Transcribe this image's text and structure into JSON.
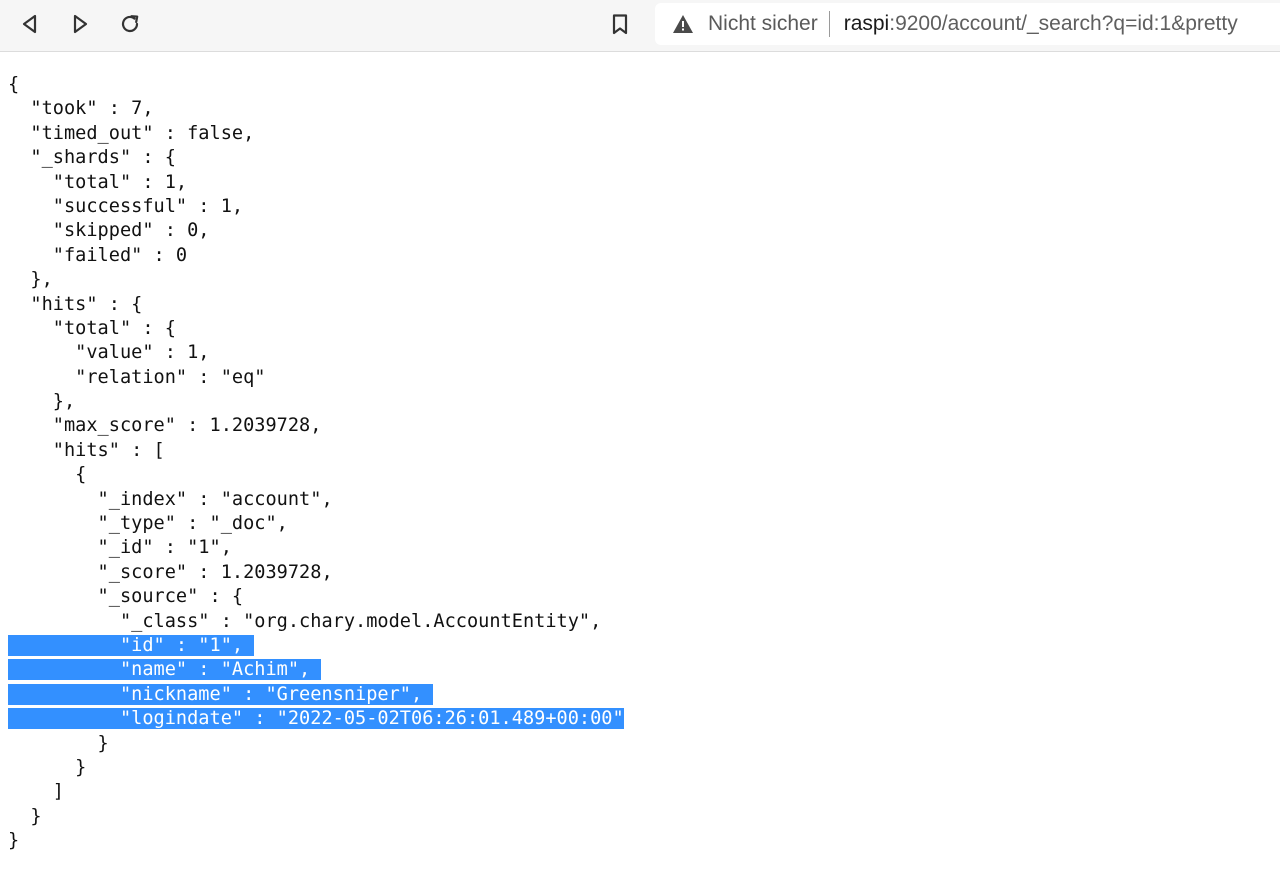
{
  "browser": {
    "security_label": "Nicht sicher",
    "url_host": "raspi",
    "url_rest": ":9200/account/_search?q=id:1&pretty",
    "icons": {
      "back": "back-arrow-icon",
      "forward": "forward-arrow-icon",
      "reload": "reload-icon",
      "bookmark": "bookmark-icon",
      "warning": "warning-triangle-icon"
    },
    "colors": {
      "selection": "#3390ff",
      "toolbar": "#f6f6f6"
    }
  },
  "json_view": {
    "lines": [
      {
        "text": "{",
        "selected": false
      },
      {
        "text": "  \"took\" : 7,",
        "selected": false
      },
      {
        "text": "  \"timed_out\" : false,",
        "selected": false
      },
      {
        "text": "  \"_shards\" : {",
        "selected": false
      },
      {
        "text": "    \"total\" : 1,",
        "selected": false
      },
      {
        "text": "    \"successful\" : 1,",
        "selected": false
      },
      {
        "text": "    \"skipped\" : 0,",
        "selected": false
      },
      {
        "text": "    \"failed\" : 0",
        "selected": false
      },
      {
        "text": "  },",
        "selected": false
      },
      {
        "text": "  \"hits\" : {",
        "selected": false
      },
      {
        "text": "    \"total\" : {",
        "selected": false
      },
      {
        "text": "      \"value\" : 1,",
        "selected": false
      },
      {
        "text": "      \"relation\" : \"eq\"",
        "selected": false
      },
      {
        "text": "    },",
        "selected": false
      },
      {
        "text": "    \"max_score\" : 1.2039728,",
        "selected": false
      },
      {
        "text": "    \"hits\" : [",
        "selected": false
      },
      {
        "text": "      {",
        "selected": false
      },
      {
        "text": "        \"_index\" : \"account\",",
        "selected": false
      },
      {
        "text": "        \"_type\" : \"_doc\",",
        "selected": false
      },
      {
        "text": "        \"_id\" : \"1\",",
        "selected": false
      },
      {
        "text": "        \"_score\" : 1.2039728,",
        "selected": false
      },
      {
        "text": "        \"_source\" : {",
        "selected": false
      },
      {
        "text": "          \"_class\" : \"org.chary.model.AccountEntity\",",
        "selected": false
      },
      {
        "text": "          \"id\" : \"1\",",
        "selected": true
      },
      {
        "text": "          \"name\" : \"Achim\",",
        "selected": true
      },
      {
        "text": "          \"nickname\" : \"Greensniper\",",
        "selected": true
      },
      {
        "text": "          \"logindate\" : \"2022-05-02T06:26:01.489+00:00\"",
        "selected": true
      },
      {
        "text": "        }",
        "selected": false
      },
      {
        "text": "      }",
        "selected": false
      },
      {
        "text": "    ]",
        "selected": false
      },
      {
        "text": "  }",
        "selected": false
      },
      {
        "text": "}",
        "selected": false
      }
    ]
  }
}
